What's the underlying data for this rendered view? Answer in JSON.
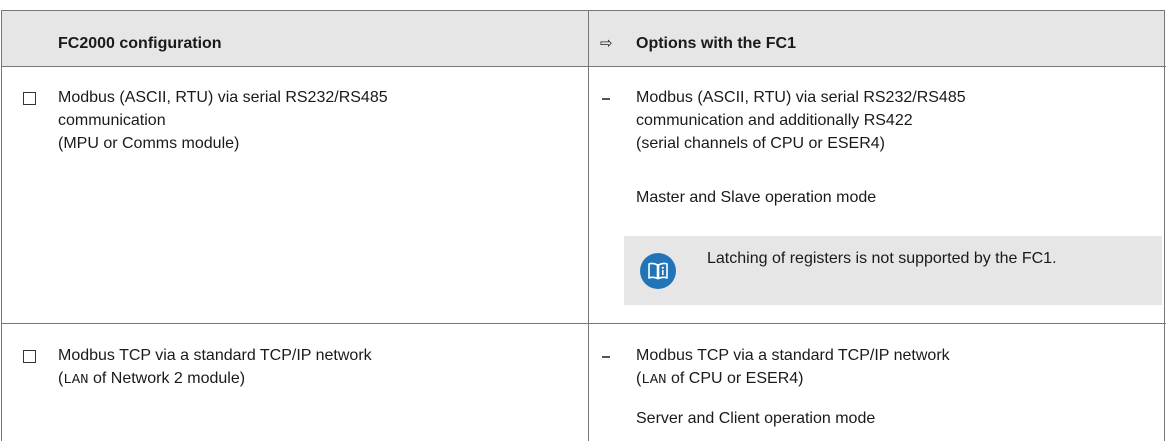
{
  "header": {
    "left_title": "FC2000 configuration",
    "right_arrow": "⇨",
    "right_title": "Options with the FC1"
  },
  "rows": [
    {
      "left_lines": [
        "Modbus (ASCII, RTU) via serial RS232/RS485",
        "communication",
        "(MPU or Comms module)"
      ],
      "right_lines": [
        "Modbus (ASCII, RTU) via serial RS232/RS485",
        "communication and additionally RS422",
        "(serial channels of CPU or ESER4)"
      ],
      "right_extra": "Master and Slave operation mode",
      "note": {
        "icon": "book-info-icon",
        "text": "Latching of registers is not supported by the FC1."
      }
    },
    {
      "left_line1": "Modbus TCP via a standard TCP/IP network",
      "left_line2_code": "LAN",
      "left_line2_rest": " of Network 2 module)",
      "left_line2_open": "(",
      "right_line1": "Modbus TCP via a standard TCP/IP network",
      "right_line2_open": "(",
      "right_line2_code": "LAN",
      "right_line2_rest": " of CPU or ESER4)",
      "right_extra": "Server and Client operation mode"
    }
  ],
  "colors": {
    "header_bg": "#e6e6e6",
    "note_bg": "#e6e6e6",
    "icon_blue": "#2274b8",
    "border": "#777777"
  }
}
